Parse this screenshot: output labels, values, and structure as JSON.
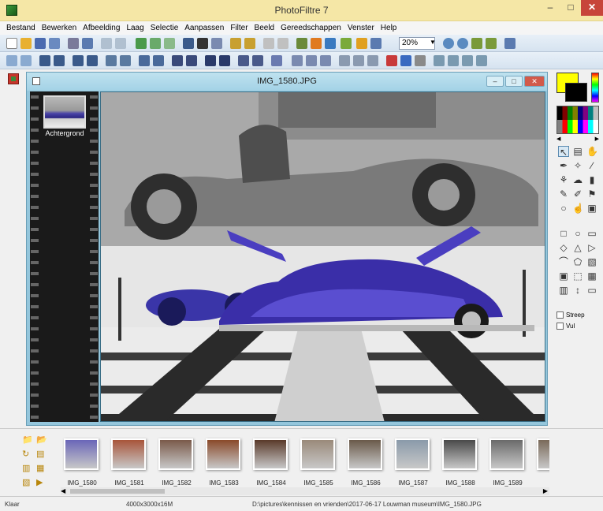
{
  "app": {
    "title": "PhotoFiltre 7",
    "menu": [
      "Bestand",
      "Bewerken",
      "Afbeelding",
      "Laag",
      "Selectie",
      "Aanpassen",
      "Filter",
      "Beeld",
      "Gereedschappen",
      "Venster",
      "Help"
    ],
    "zoom": "20%"
  },
  "document": {
    "title": "IMG_1580.JPG",
    "layer_label": "Achtergrond"
  },
  "tools": {
    "streep_label": "Streep",
    "vul_label": "Vul"
  },
  "browser": {
    "thumbs": [
      {
        "label": "IMG_1580",
        "color": "#6a66b8"
      },
      {
        "label": "IMG_1581",
        "color": "#a8553a"
      },
      {
        "label": "IMG_1582",
        "color": "#7a5a4a"
      },
      {
        "label": "IMG_1583",
        "color": "#8a4a2a"
      },
      {
        "label": "IMG_1584",
        "color": "#5a3a2a"
      },
      {
        "label": "IMG_1585",
        "color": "#9a8a7a"
      },
      {
        "label": "IMG_1586",
        "color": "#6a5a4a"
      },
      {
        "label": "IMG_1587",
        "color": "#8a9aaa"
      },
      {
        "label": "IMG_1588",
        "color": "#4a4a4a"
      },
      {
        "label": "IMG_1589",
        "color": "#6a6a6a"
      },
      {
        "label": "IMG",
        "color": "#7a6a5a"
      }
    ]
  },
  "status": {
    "state": "Klaar",
    "dimensions": "4000x3000x16M",
    "path": "D:\\pictures\\kennissen en vrienden\\2017-06-17 Louwman museum\\IMG_1580.JPG"
  }
}
